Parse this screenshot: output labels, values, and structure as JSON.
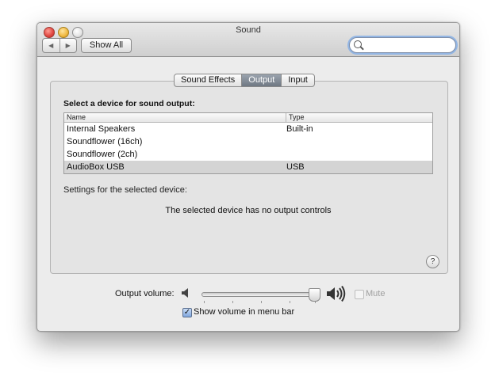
{
  "window": {
    "title": "Sound",
    "back_glyph": "◀",
    "forward_glyph": "▶",
    "show_all_label": "Show All",
    "search": {
      "value": "",
      "placeholder": ""
    }
  },
  "tabs": [
    {
      "label": "Sound Effects",
      "selected": false
    },
    {
      "label": "Output",
      "selected": true
    },
    {
      "label": "Input",
      "selected": false
    }
  ],
  "output": {
    "heading": "Select a device for sound output:",
    "columns": {
      "name": "Name",
      "type": "Type"
    },
    "devices": [
      {
        "name": "Internal Speakers",
        "type": "Built-in",
        "selected": false
      },
      {
        "name": "Soundflower (16ch)",
        "type": "",
        "selected": false
      },
      {
        "name": "Soundflower (2ch)",
        "type": "",
        "selected": false
      },
      {
        "name": "AudioBox USB",
        "type": "USB",
        "selected": true
      }
    ],
    "settings_label": "Settings for the selected device:",
    "no_controls_message": "The selected device has no output controls"
  },
  "help_glyph": "?",
  "volume": {
    "label": "Output volume:",
    "level": 0.97,
    "mute_label": "Mute",
    "mute_checked": false,
    "mute_enabled": false,
    "show_in_menu_bar_label": "Show volume in menu bar",
    "show_in_menu_bar_checked": true,
    "check_glyph": "✓"
  },
  "colors": {
    "selected_tab": "#7a838e",
    "selected_row": "#d4d4d4",
    "search_focus": "#93b6e4"
  }
}
